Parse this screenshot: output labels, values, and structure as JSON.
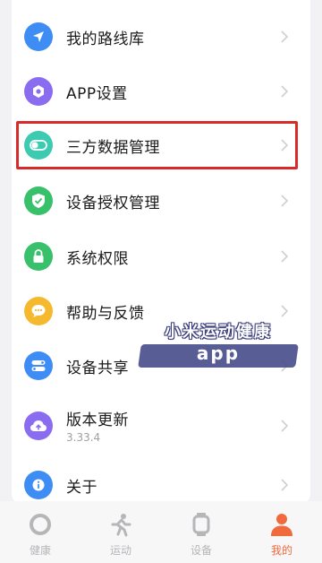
{
  "menu": {
    "items": [
      {
        "label": "我的路线库",
        "icon": "navigation-arrow-icon",
        "color": "#3d8df5"
      },
      {
        "label": "APP设置",
        "icon": "gear-icon",
        "color": "#8a6cf0"
      },
      {
        "label": "三方数据管理",
        "icon": "toggle-icon",
        "color": "#3ccab0"
      },
      {
        "label": "设备授权管理",
        "icon": "shield-check-icon",
        "color": "#38c06a"
      },
      {
        "label": "系统权限",
        "icon": "lock-icon",
        "color": "#38c06a"
      },
      {
        "label": "帮助与反馈",
        "icon": "chat-bubble-icon",
        "color": "#f5b92d"
      },
      {
        "label": "设备共享",
        "icon": "share-toggle-icon",
        "color": "#3d8df5"
      },
      {
        "label": "版本更新",
        "sublabel": "3.33.4",
        "icon": "cloud-upload-icon",
        "color": "#8a6cf0"
      },
      {
        "label": "关于",
        "icon": "info-icon",
        "color": "#3d8df5"
      }
    ],
    "highlighted_index": 2,
    "highlight_color": "#d62b28"
  },
  "watermark": {
    "line1": "小米运动健康",
    "line2": "app"
  },
  "tabbar": {
    "tabs": [
      {
        "label": "健康",
        "icon": "health-ring-icon"
      },
      {
        "label": "运动",
        "icon": "running-person-icon"
      },
      {
        "label": "设备",
        "icon": "watch-icon"
      },
      {
        "label": "我的",
        "icon": "person-icon",
        "active": true
      }
    ],
    "active_color": "#f06a3d",
    "inactive_color": "#b6b6b8"
  }
}
